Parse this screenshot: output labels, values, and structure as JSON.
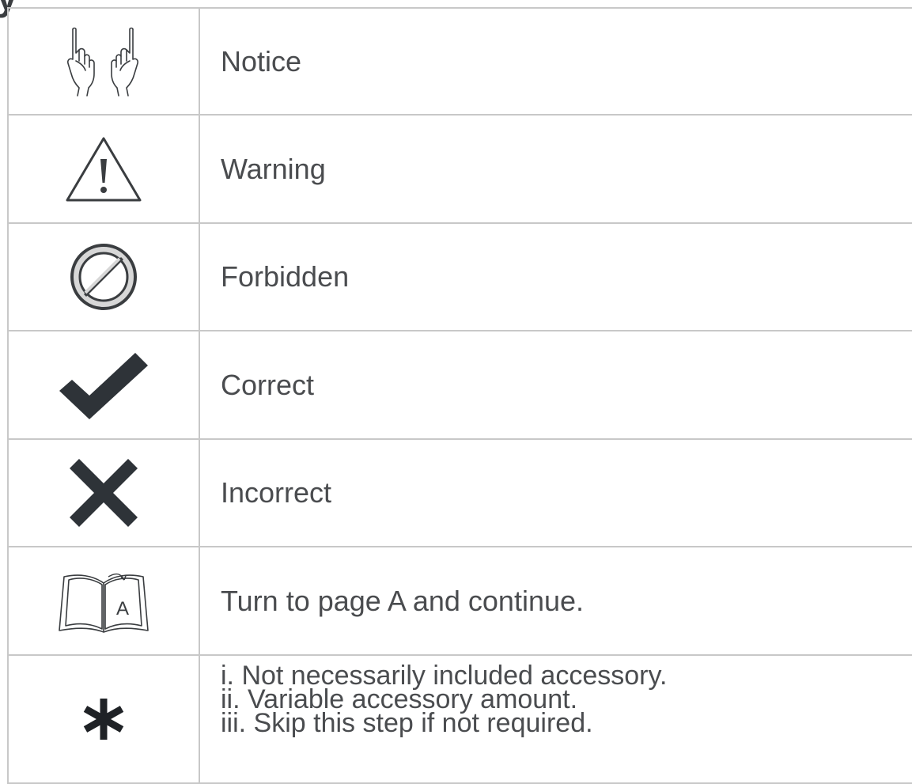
{
  "header": {
    "cutoff_glyph": "y"
  },
  "rows": [
    {
      "icon": "hands-pointing-up-icon",
      "label": "Notice"
    },
    {
      "icon": "warning-triangle-icon",
      "label": "Warning"
    },
    {
      "icon": "forbidden-icon",
      "label": "Forbidden"
    },
    {
      "icon": "checkmark-icon",
      "label": "Correct"
    },
    {
      "icon": "cross-icon",
      "label": "Incorrect"
    },
    {
      "icon": "open-book-icon",
      "label": "Turn to page A and continue.",
      "icon_text": "A"
    },
    {
      "icon": "asterisk-icon",
      "lines": [
        "i. Not necessarily included accessory.",
        "ii. Variable accessory amount.",
        "iii. Skip this step if not required."
      ]
    }
  ],
  "colors": {
    "icon": "#2e3338",
    "text": "#4a4c4f",
    "grid": "#c8c8c8"
  }
}
